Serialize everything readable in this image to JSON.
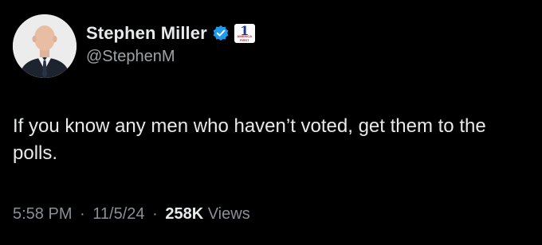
{
  "author": {
    "display_name": "Stephen Miller",
    "handle": "@StephenM",
    "verified_icon": "verified-badge-icon",
    "affiliate_badge": {
      "number": "1",
      "subtext": "AMERICA FIRST"
    }
  },
  "tweet": {
    "text": "If you know any men who haven’t voted, get them to the polls."
  },
  "meta": {
    "time": "5:58 PM",
    "separator": "·",
    "date": "11/5/24",
    "views_count": "258K",
    "views_label": "Views"
  },
  "colors": {
    "background": "#000000",
    "text": "#e7e9ea",
    "secondary": "#8b8f95",
    "verified_blue": "#1d9bf0"
  }
}
